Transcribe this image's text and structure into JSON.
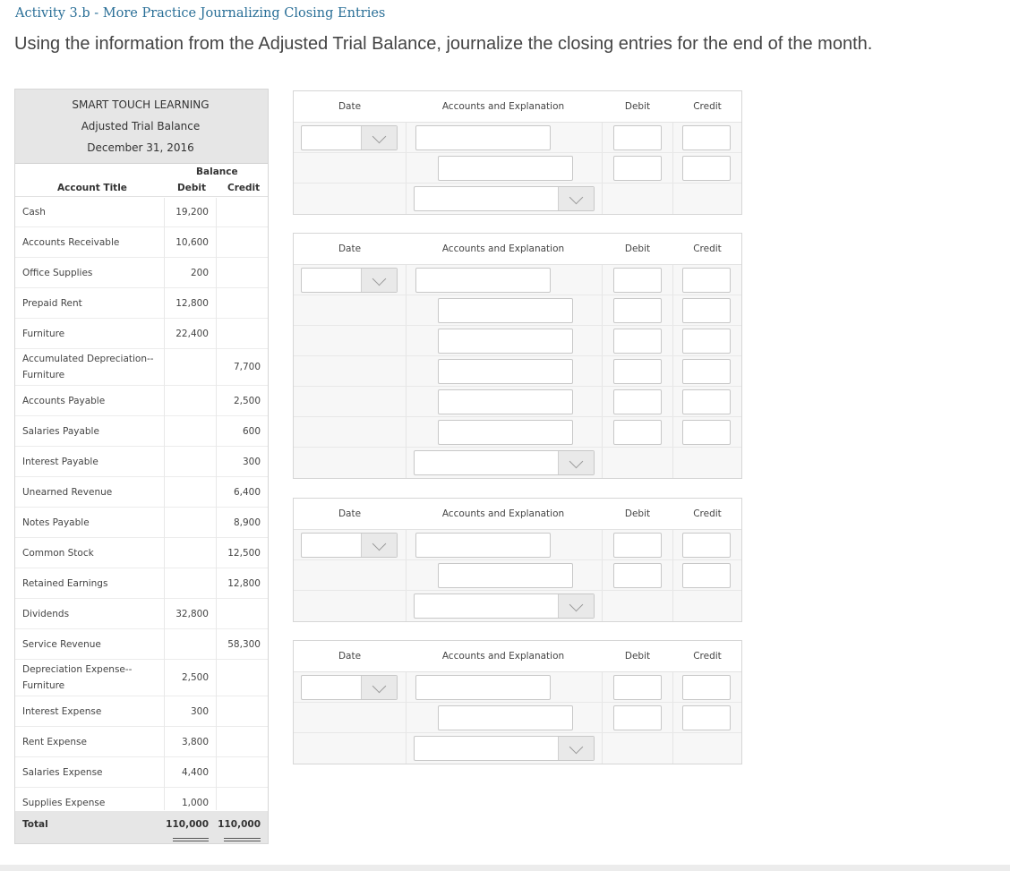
{
  "header": {
    "activity_title": "Activity 3.b - More Practice Journalizing Closing Entries",
    "instructions": "Using the information from the Adjusted Trial Balance, journalize the closing entries for the end of the month."
  },
  "trial_balance": {
    "company": "SMART TOUCH LEARNING",
    "report": "Adjusted Trial Balance",
    "date": "December 31, 2016",
    "balance_label": "Balance",
    "account_title_label": "Account Title",
    "debit_label": "Debit",
    "credit_label": "Credit",
    "rows": [
      {
        "account": "Cash",
        "debit": "19,200",
        "credit": ""
      },
      {
        "account": "Accounts Receivable",
        "debit": "10,600",
        "credit": ""
      },
      {
        "account": "Office Supplies",
        "debit": "200",
        "credit": ""
      },
      {
        "account": "Prepaid Rent",
        "debit": "12,800",
        "credit": ""
      },
      {
        "account": "Furniture",
        "debit": "22,400",
        "credit": ""
      },
      {
        "account": "Accumulated Depreciation--Furniture",
        "debit": "",
        "credit": "7,700"
      },
      {
        "account": "Accounts Payable",
        "debit": "",
        "credit": "2,500"
      },
      {
        "account": "Salaries Payable",
        "debit": "",
        "credit": "600"
      },
      {
        "account": "Interest Payable",
        "debit": "",
        "credit": "300"
      },
      {
        "account": "Unearned Revenue",
        "debit": "",
        "credit": "6,400"
      },
      {
        "account": "Notes Payable",
        "debit": "",
        "credit": "8,900"
      },
      {
        "account": "Common Stock",
        "debit": "",
        "credit": "12,500"
      },
      {
        "account": "Retained Earnings",
        "debit": "",
        "credit": "12,800"
      },
      {
        "account": "Dividends",
        "debit": "32,800",
        "credit": ""
      },
      {
        "account": "Service Revenue",
        "debit": "",
        "credit": "58,300"
      },
      {
        "account": "Depreciation Expense--Furniture",
        "debit": "2,500",
        "credit": ""
      },
      {
        "account": "Interest Expense",
        "debit": "300",
        "credit": ""
      },
      {
        "account": "Rent Expense",
        "debit": "3,800",
        "credit": ""
      },
      {
        "account": "Salaries Expense",
        "debit": "4,400",
        "credit": ""
      },
      {
        "account": "Supplies Expense",
        "debit": "1,000",
        "credit": ""
      }
    ],
    "total": {
      "label": "Total",
      "debit": "110,000",
      "credit": "110,000"
    }
  },
  "journal_headers": {
    "date": "Date",
    "accounts": "Accounts and Explanation",
    "debit": "Debit",
    "credit": "Credit"
  },
  "journals": [
    {
      "account_lines": 2
    },
    {
      "account_lines": 6
    },
    {
      "account_lines": 2
    },
    {
      "account_lines": 2
    }
  ]
}
